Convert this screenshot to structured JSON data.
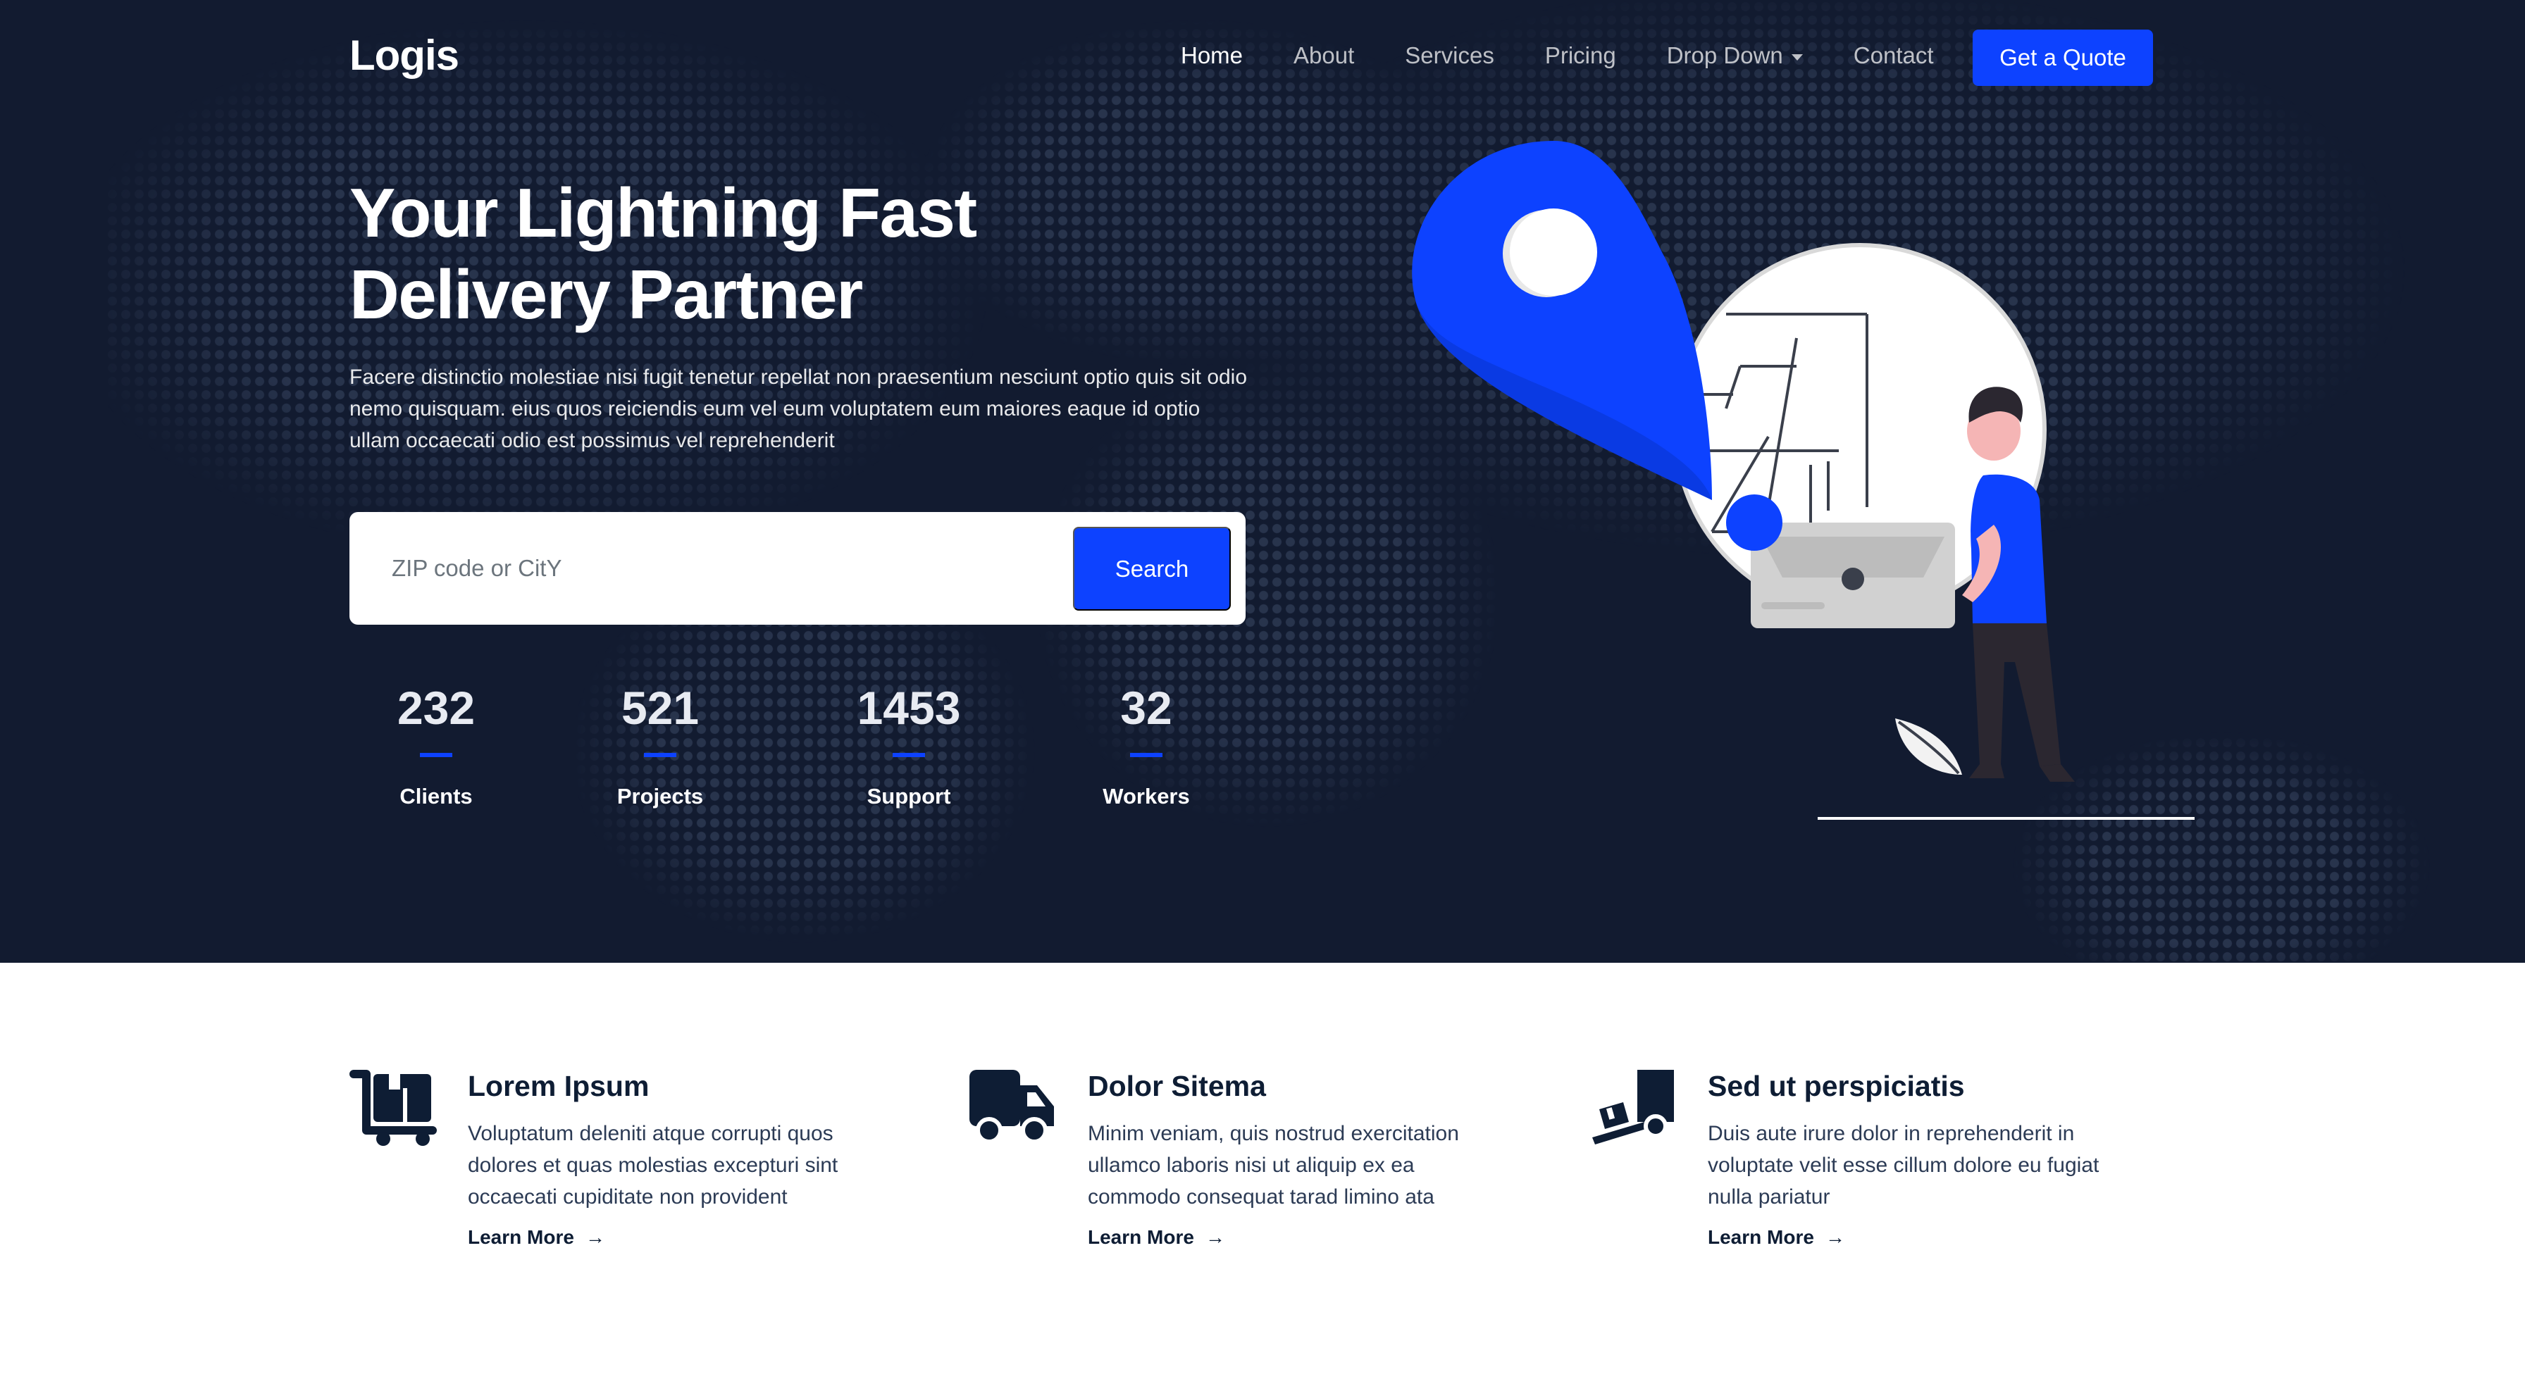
{
  "brand": {
    "name": "Logis",
    "accent": "#0d42ff",
    "hero_bg": "#121b30"
  },
  "nav": {
    "items": [
      {
        "label": "Home",
        "active": true
      },
      {
        "label": "About"
      },
      {
        "label": "Services"
      },
      {
        "label": "Pricing"
      },
      {
        "label": "Drop Down",
        "dropdown": true
      },
      {
        "label": "Contact"
      }
    ],
    "cta": "Get a Quote"
  },
  "hero": {
    "title_line1": "Your Lightning Fast",
    "title_line2": "Delivery Partner",
    "description": "Facere distinctio molestiae nisi fugit tenetur repellat non praesentium nesciunt optio quis sit odio nemo quisquam. eius quos reiciendis eum vel eum voluptatem eum maiores eaque id optio ullam occaecati odio est possimus vel reprehenderit",
    "search": {
      "placeholder": "ZIP code or CitY",
      "value": "",
      "button": "Search"
    },
    "stats": [
      {
        "value": "232",
        "label": "Clients"
      },
      {
        "value": "521",
        "label": "Projects"
      },
      {
        "value": "1453",
        "label": "Support"
      },
      {
        "value": "32",
        "label": "Workers"
      }
    ]
  },
  "features": [
    {
      "icon": "cart-flatbed-boxes-icon",
      "title": "Lorem Ipsum",
      "description": "Voluptatum deleniti atque corrupti quos dolores et quas molestias excepturi sint occaecati cupiditate non provident",
      "link": "Learn More"
    },
    {
      "icon": "truck-icon",
      "title": "Dolor Sitema",
      "description": "Minim veniam, quis nostrud exercitation ullamco laboris nisi ut aliquip ex ea commodo consequat tarad limino ata",
      "link": "Learn More"
    },
    {
      "icon": "truck-ramp-box-icon",
      "title": "Sed ut perspiciatis",
      "description": "Duis aute irure dolor in reprehenderit in voluptate velit esse cillum dolore eu fugiat nulla pariatur",
      "link": "Learn More"
    }
  ]
}
